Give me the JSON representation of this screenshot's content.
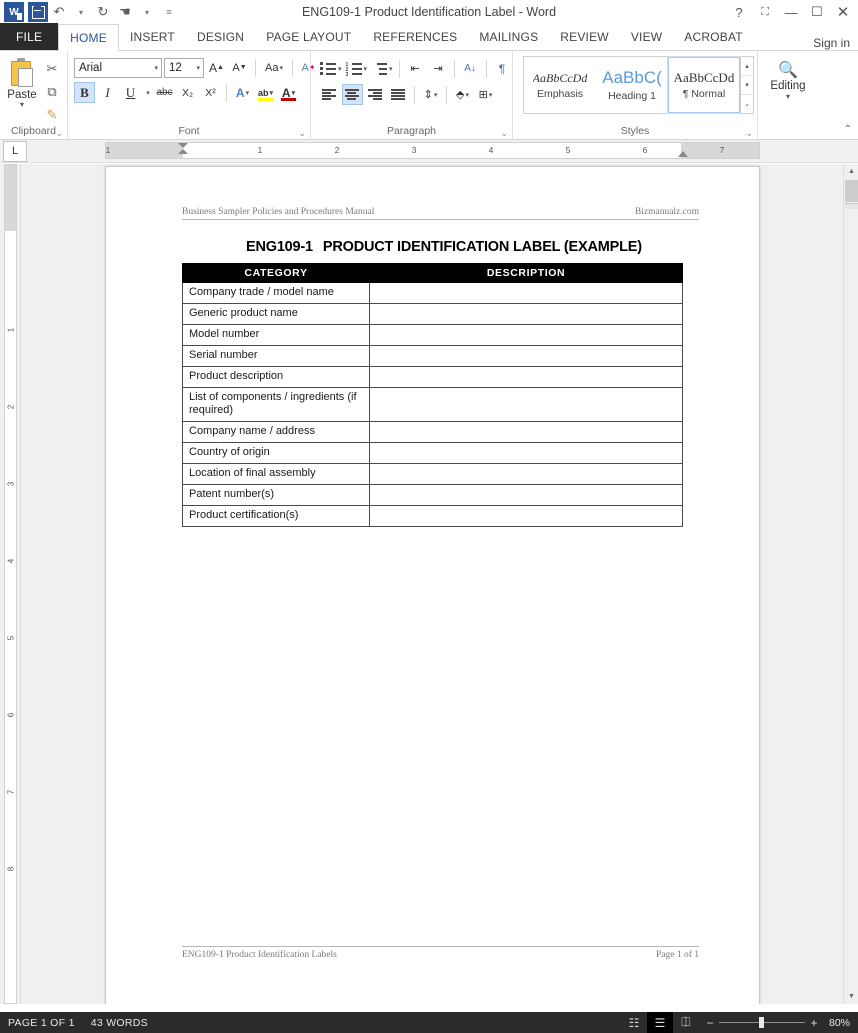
{
  "titlebar": {
    "document_title": "ENG109-1 Product Identification Label - Word",
    "quick_access": [
      {
        "name": "word-logo-icon",
        "label": "W"
      },
      {
        "name": "save-icon",
        "label": "Save"
      },
      {
        "name": "undo-icon",
        "label": "↶"
      },
      {
        "name": "redo-icon",
        "label": "↻"
      },
      {
        "name": "touch-mode-icon",
        "label": "☚"
      },
      {
        "name": "customize-qat-icon",
        "label": "≡"
      }
    ],
    "window_controls": [
      {
        "name": "help-button",
        "label": "?"
      },
      {
        "name": "ribbon-display-options-button",
        "label": "⬚"
      },
      {
        "name": "minimize-button",
        "label": "—"
      },
      {
        "name": "maximize-button",
        "label": "☐"
      },
      {
        "name": "close-button",
        "label": "✕"
      }
    ]
  },
  "ribbon": {
    "tabs": [
      {
        "label": "FILE",
        "active": false
      },
      {
        "label": "HOME",
        "active": true
      },
      {
        "label": "INSERT",
        "active": false
      },
      {
        "label": "DESIGN",
        "active": false
      },
      {
        "label": "PAGE LAYOUT",
        "active": false
      },
      {
        "label": "REFERENCES",
        "active": false
      },
      {
        "label": "MAILINGS",
        "active": false
      },
      {
        "label": "REVIEW",
        "active": false
      },
      {
        "label": "VIEW",
        "active": false
      },
      {
        "label": "ACROBAT",
        "active": false
      }
    ],
    "signin_label": "Sign in",
    "groups": {
      "clipboard": {
        "label": "Clipboard",
        "paste_label": "Paste",
        "items": [
          {
            "name": "cut-icon",
            "label": "✂"
          },
          {
            "name": "copy-icon",
            "label": "⧉"
          },
          {
            "name": "format-painter-icon",
            "label": "✎"
          }
        ]
      },
      "font": {
        "label": "Font",
        "font_name": "Arial",
        "font_size": "12",
        "buttons": [
          {
            "name": "grow-font-button",
            "label": "A▴"
          },
          {
            "name": "shrink-font-button",
            "label": "A▾"
          },
          {
            "name": "change-case-button",
            "label": "Aa"
          },
          {
            "name": "clear-formatting-button",
            "label": "A⊘"
          },
          {
            "name": "bold-button",
            "label": "B",
            "active": true
          },
          {
            "name": "italic-button",
            "label": "I"
          },
          {
            "name": "underline-button",
            "label": "U"
          },
          {
            "name": "strikethrough-button",
            "label": "abc"
          },
          {
            "name": "subscript-button",
            "label": "X₂"
          },
          {
            "name": "superscript-button",
            "label": "X²"
          },
          {
            "name": "text-effects-button",
            "label": "A"
          },
          {
            "name": "text-highlight-button",
            "label": "ab"
          },
          {
            "name": "font-color-button",
            "label": "A"
          }
        ]
      },
      "paragraph": {
        "label": "Paragraph",
        "buttons": [
          {
            "name": "bullets-button",
            "label": "bullets"
          },
          {
            "name": "numbering-button",
            "label": "numbering"
          },
          {
            "name": "multilevel-list-button",
            "label": "multilevel"
          },
          {
            "name": "decrease-indent-button",
            "label": "⇤"
          },
          {
            "name": "increase-indent-button",
            "label": "⇥"
          },
          {
            "name": "sort-button",
            "label": "A↓"
          },
          {
            "name": "show-formatting-marks-button",
            "label": "¶"
          },
          {
            "name": "align-left-button",
            "label": "align-left"
          },
          {
            "name": "align-center-button",
            "label": "align-center",
            "active": true
          },
          {
            "name": "align-right-button",
            "label": "align-right"
          },
          {
            "name": "justify-button",
            "label": "justify"
          },
          {
            "name": "line-spacing-button",
            "label": "↕"
          },
          {
            "name": "shading-button",
            "label": "shading"
          },
          {
            "name": "borders-button",
            "label": "borders"
          }
        ]
      },
      "styles": {
        "label": "Styles",
        "items": [
          {
            "preview": "AaBbCcDd",
            "name": "Emphasis",
            "selected": false
          },
          {
            "preview": "AaBbC(",
            "name": "Heading 1",
            "selected": false
          },
          {
            "preview": "AaBbCcDd",
            "name": "¶ Normal",
            "selected": true
          }
        ]
      },
      "editing": {
        "label": "Editing",
        "button_label": "Editing"
      }
    },
    "collapse_label": "⌃"
  },
  "ruler": {
    "tabstop_marker": "L",
    "h_numbers": [
      "1",
      "1",
      "2",
      "3",
      "4",
      "5",
      "6",
      "7"
    ],
    "v_numbers": [
      "1",
      "2",
      "3",
      "4",
      "5",
      "6",
      "7",
      "8"
    ]
  },
  "document": {
    "header": {
      "left": "Business Sampler Policies and Procedures Manual",
      "right": "Bizmanualz.com"
    },
    "title": {
      "code": "ENG109-1",
      "text": "PRODUCT IDENTIFICATION LABEL (EXAMPLE)"
    },
    "table": {
      "columns": [
        "CATEGORY",
        "DESCRIPTION"
      ],
      "rows": [
        {
          "category": "Company trade / model name",
          "description": ""
        },
        {
          "category": "Generic product name",
          "description": ""
        },
        {
          "category": "Model number",
          "description": ""
        },
        {
          "category": "Serial number",
          "description": ""
        },
        {
          "category": "Product description",
          "description": ""
        },
        {
          "category": "List of components / ingredients (if required)",
          "description": ""
        },
        {
          "category": "Company name / address",
          "description": ""
        },
        {
          "category": "Country of origin",
          "description": ""
        },
        {
          "category": "Location of final assembly",
          "description": ""
        },
        {
          "category": "Patent number(s)",
          "description": ""
        },
        {
          "category": "Product certification(s)",
          "description": ""
        }
      ]
    },
    "footer": {
      "left": "ENG109-1 Product Identification Labels",
      "right": "Page 1 of 1"
    }
  },
  "statusbar": {
    "page_info": "PAGE 1 OF 1",
    "word_count": "43 WORDS",
    "views": [
      {
        "name": "read-mode-button",
        "label": "☷",
        "active": false
      },
      {
        "name": "print-layout-button",
        "label": "☰",
        "active": true
      },
      {
        "name": "web-layout-button",
        "label": "⎅",
        "active": false
      }
    ],
    "zoom_out_label": "−",
    "zoom_in_label": "+",
    "zoom_level": "80%"
  }
}
